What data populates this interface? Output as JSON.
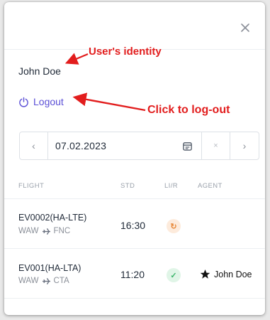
{
  "user": {
    "name": "John Doe"
  },
  "logout": {
    "label": "Logout"
  },
  "annotations": {
    "identity": "User's identity",
    "logout": "Click to log-out"
  },
  "date_picker": {
    "value": "07.02.2023",
    "prev_icon": "chevron-left-icon",
    "next_icon": "chevron-right-icon",
    "calendar_icon": "calendar-icon",
    "clear_icon": "close-icon"
  },
  "table": {
    "headers": {
      "flight": "FLIGHT",
      "std": "STD",
      "lir": "LI/R",
      "agent": "AGENT"
    },
    "rows": [
      {
        "flight": "EV0002(HA-LTE)",
        "from": "WAW",
        "to": "FNC",
        "std": "16:30",
        "lir_status": "sync-icon",
        "agent": ""
      },
      {
        "flight": "EV001(HA-LTA)",
        "from": "WAW",
        "to": "CTA",
        "std": "11:20",
        "lir_status": "check-icon",
        "agent": "John Doe"
      }
    ]
  },
  "colors": {
    "accent": "#5b4fd6",
    "annotation": "#e21d1d",
    "warn": "#e8893a",
    "ok": "#3cb46b"
  }
}
